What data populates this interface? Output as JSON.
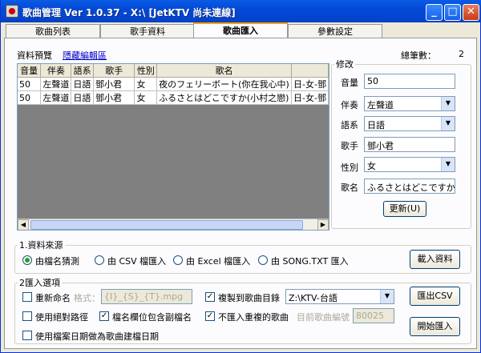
{
  "window": {
    "title": "歌曲管理  Ver 1.0.37 - X:\\  [JetKTV 尚未連線]",
    "min_glyph": "_",
    "max_glyph": "□",
    "close_glyph": "✕"
  },
  "tabs": [
    {
      "label": "歌曲列表",
      "active": false
    },
    {
      "label": "歌手資料",
      "active": false
    },
    {
      "label": "歌曲匯入",
      "active": true
    },
    {
      "label": "參數設定",
      "active": false
    }
  ],
  "preview": {
    "label": "資料預覽",
    "hide_link": "隱藏編輯區",
    "total_label": "總筆數：",
    "total_value": "2"
  },
  "grid": {
    "columns": [
      "音量",
      "伴奏",
      "語系",
      "歌手",
      "性別",
      "歌名",
      ""
    ],
    "rows": [
      [
        "50",
        "左聲道",
        "日語",
        "鄧小君",
        "女",
        "夜のフェリーボート(你在我心中)",
        "日-女-鄧"
      ],
      [
        "50",
        "左聲道",
        "日語",
        "鄧小君",
        "女",
        "ふるさとはどこですか(小村之戀)",
        "日-女-鄧"
      ]
    ],
    "scroll_left": "◀",
    "scroll_right": "▶"
  },
  "edit": {
    "legend": "修改",
    "fields": [
      {
        "label": "音量",
        "value": "50",
        "type": "text"
      },
      {
        "label": "伴奏",
        "value": "左聲道",
        "type": "combo"
      },
      {
        "label": "語系",
        "value": "日語",
        "type": "combo"
      },
      {
        "label": "歌手",
        "value": "鄧小君",
        "type": "text"
      },
      {
        "label": "性別",
        "value": "女",
        "type": "combo"
      },
      {
        "label": "歌名",
        "value": "ふるさとはどこですか",
        "type": "text"
      }
    ],
    "update_button": "更新(U)",
    "dropdown_glyph": "▼"
  },
  "source": {
    "legend": "1.資料來源",
    "options": [
      {
        "label": "由檔名猜測",
        "selected": true
      },
      {
        "label": "由 CSV 檔匯入",
        "selected": false
      },
      {
        "label": "由 Excel 檔匯入",
        "selected": false
      },
      {
        "label": "由 SONG.TXT 匯入",
        "selected": false
      }
    ],
    "load_button": "載入資料"
  },
  "import_options": {
    "legend": "2匯入選項",
    "rename_label": "重新命名",
    "format_label": "格式：",
    "format_value": "{I}_{S}_{T}.mpg",
    "relative_path_label": "使用絕對路徑",
    "filename_sub_label": "檔名欄位包含副檔名",
    "copy_label": "複製到歌曲目錄",
    "copy_target": "Z:\\KTV-台語",
    "skip_dup_label": "不匯入重複的歌曲",
    "current_id_label": "目前歌曲編號",
    "current_id_value": "80025",
    "file_date_label": "使用檔案日期做為歌曲建檔日期",
    "export_button": "匯出CSV",
    "start_button": "開始匯入",
    "checkmark": "✓",
    "checks": {
      "rename": false,
      "relative_path": false,
      "filename_sub": true,
      "copy": true,
      "skip_dup": true,
      "file_date": false
    }
  }
}
